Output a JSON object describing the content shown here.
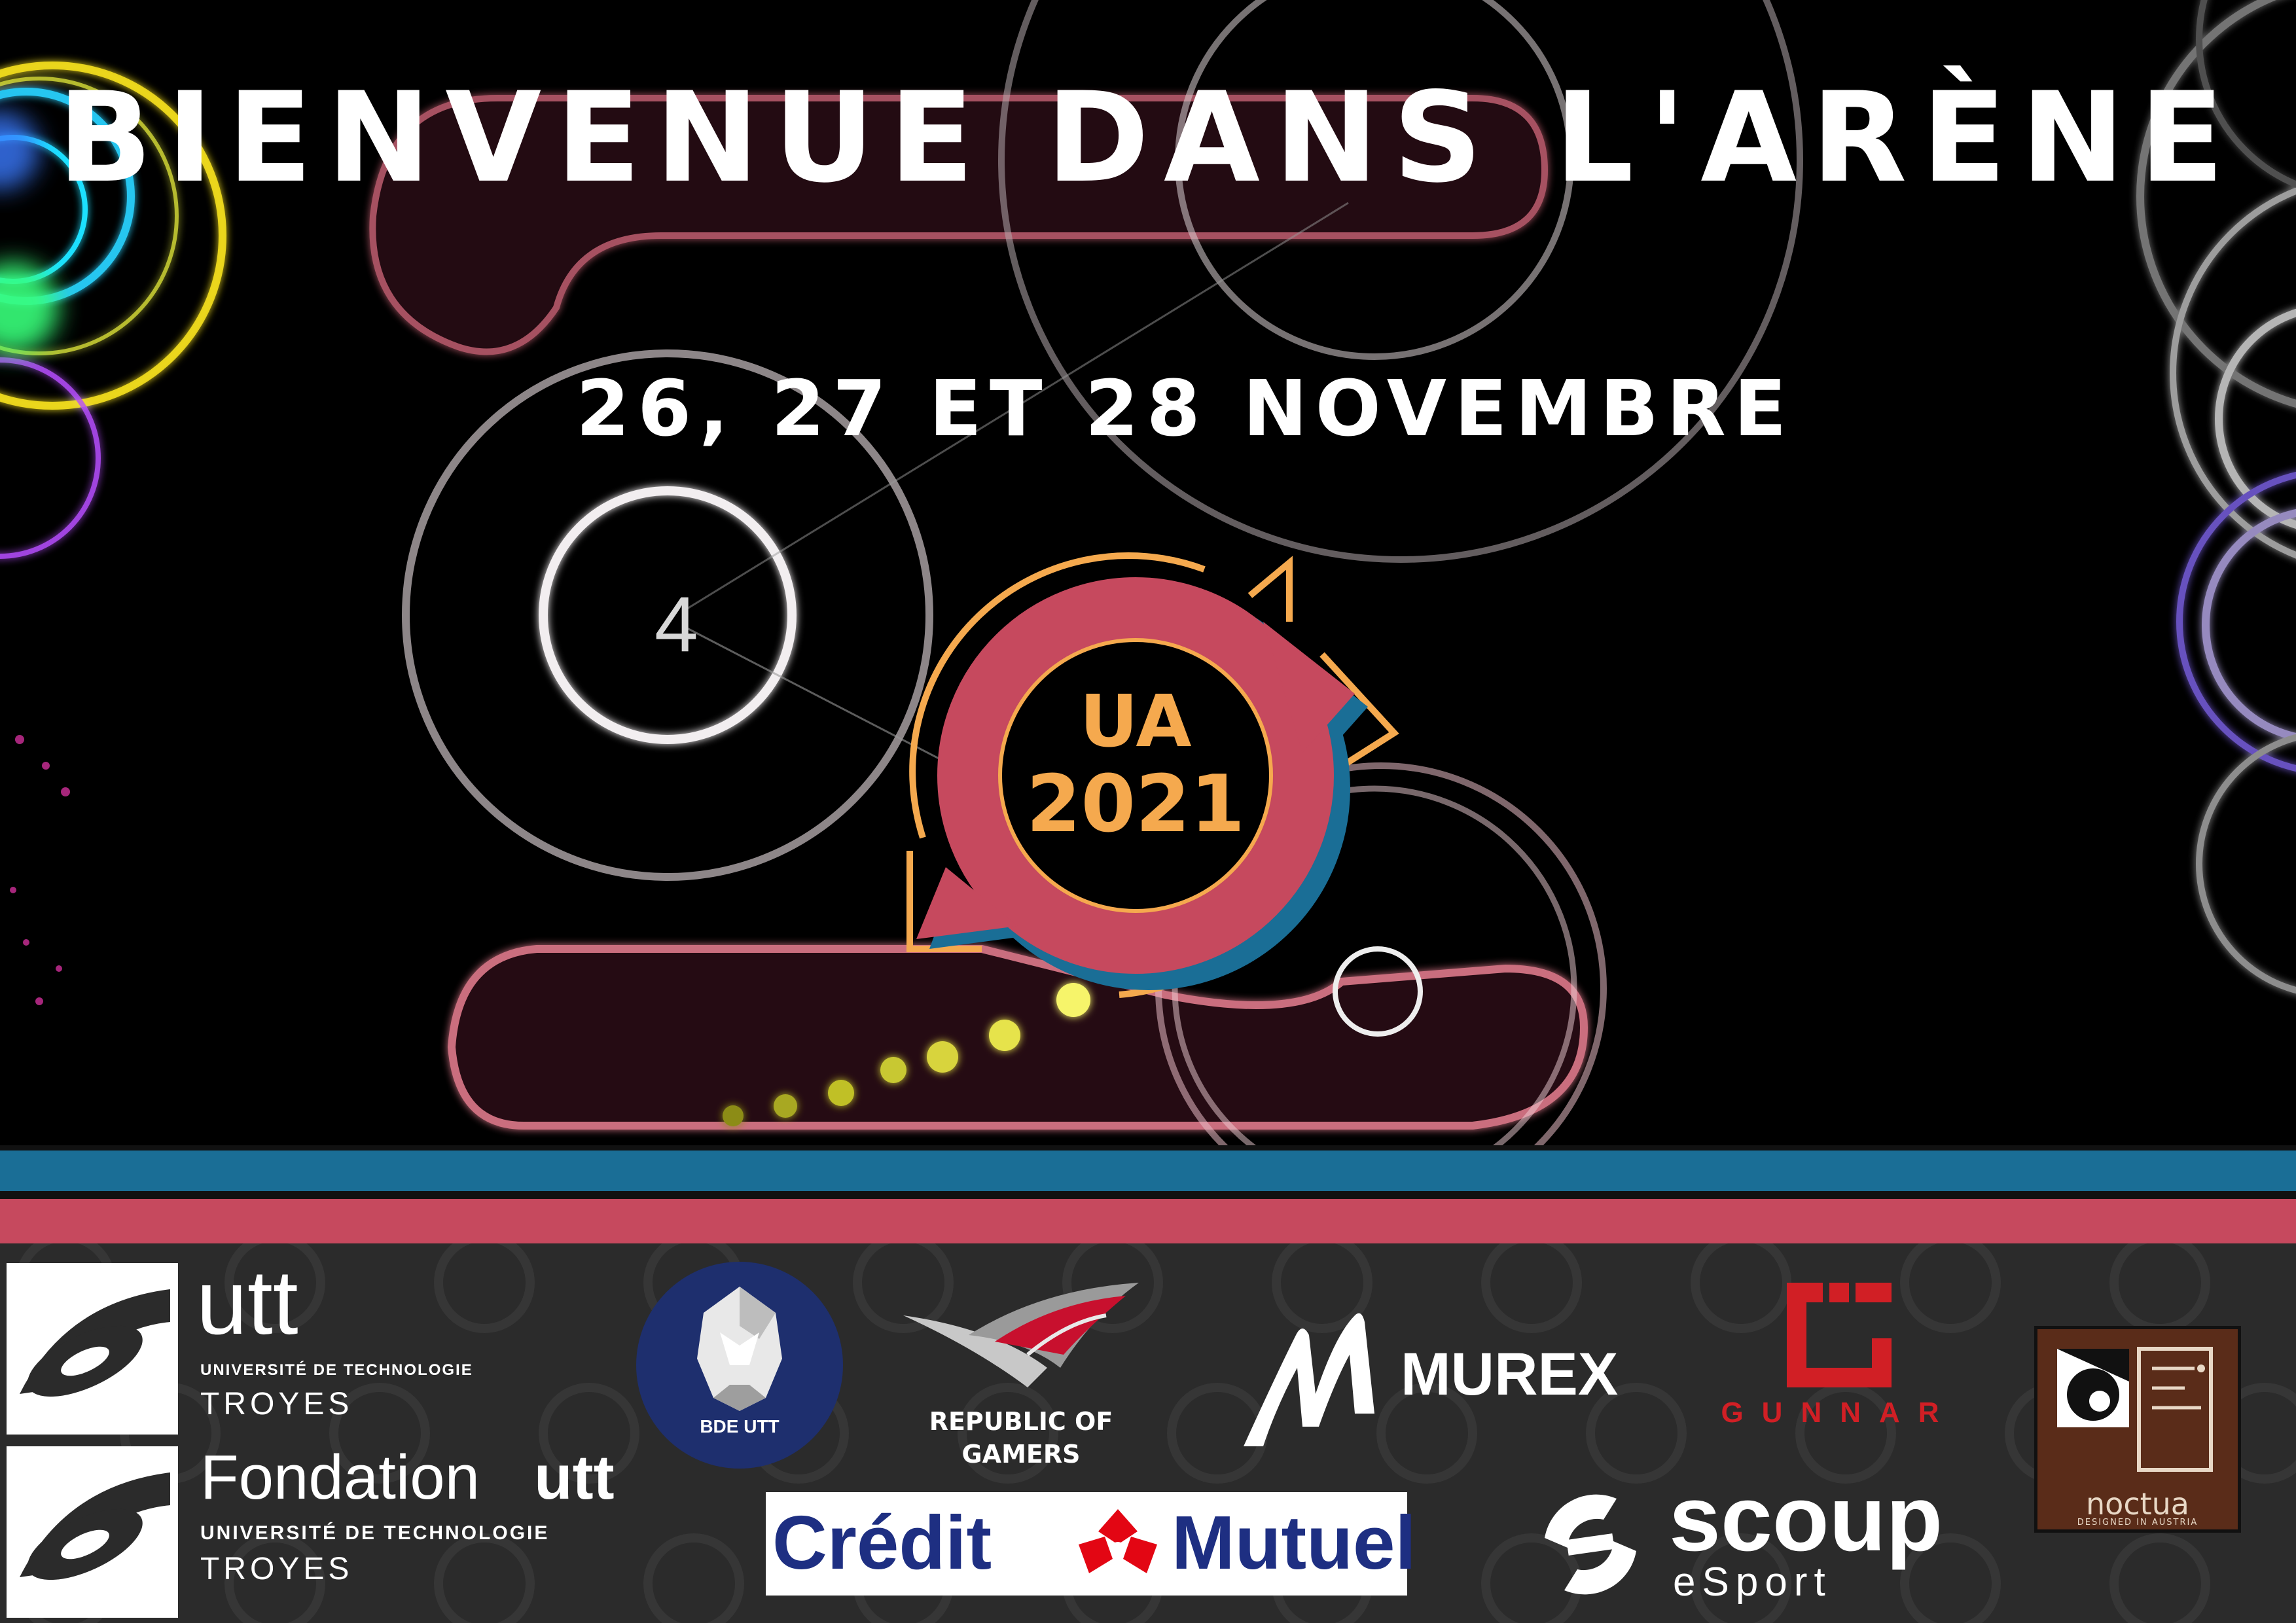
{
  "event": {
    "title": "Bienvenue dans l'arène",
    "dates": "26, 27 et 28 novembre",
    "logo_line1": "UA",
    "logo_line2": "2021",
    "background_number": "4"
  },
  "colors": {
    "background": "#000000",
    "stripe_blue": "#1a6e96",
    "stripe_pink": "#c6495e",
    "logo_pink": "#c6495e",
    "logo_orange": "#f5a94e",
    "logo_blue": "#1a6e96",
    "sponsor_band": "#2b2b2b"
  },
  "sponsors": {
    "utt": {
      "name": "utt",
      "subtitle": "UNIVERSITÉ DE TECHNOLOGIE",
      "city": "TROYES",
      "icon": "utt-eye-icon"
    },
    "fondation": {
      "name_prefix": "Fondation",
      "name_suffix": "utt",
      "subtitle": "UNIVERSITÉ DE TECHNOLOGIE",
      "city": "TROYES",
      "icon": "utt-eye-icon"
    },
    "bde": {
      "label": "BDE UTT",
      "icon": "bde-lion-icon"
    },
    "rog": {
      "line1": "REPUBLIC OF",
      "line2": "GAMERS",
      "icon": "rog-eye-icon"
    },
    "murex": {
      "label": "MUREX",
      "icon": "murex-m-icon"
    },
    "gunnar": {
      "label": "GUNNAR",
      "icon": "gunnar-frame-icon"
    },
    "noctua": {
      "label": "noctua",
      "subtitle": "DESIGNED IN AUSTRIA",
      "icon": "noctua-owl-icon"
    },
    "credit_mutuel": {
      "word1": "Crédit",
      "word2": "Mutuel",
      "icon": "credit-mutuel-icon"
    },
    "scoup": {
      "name": "scoup",
      "subtitle": "eSport",
      "icon": "scoup-s-icon"
    }
  }
}
